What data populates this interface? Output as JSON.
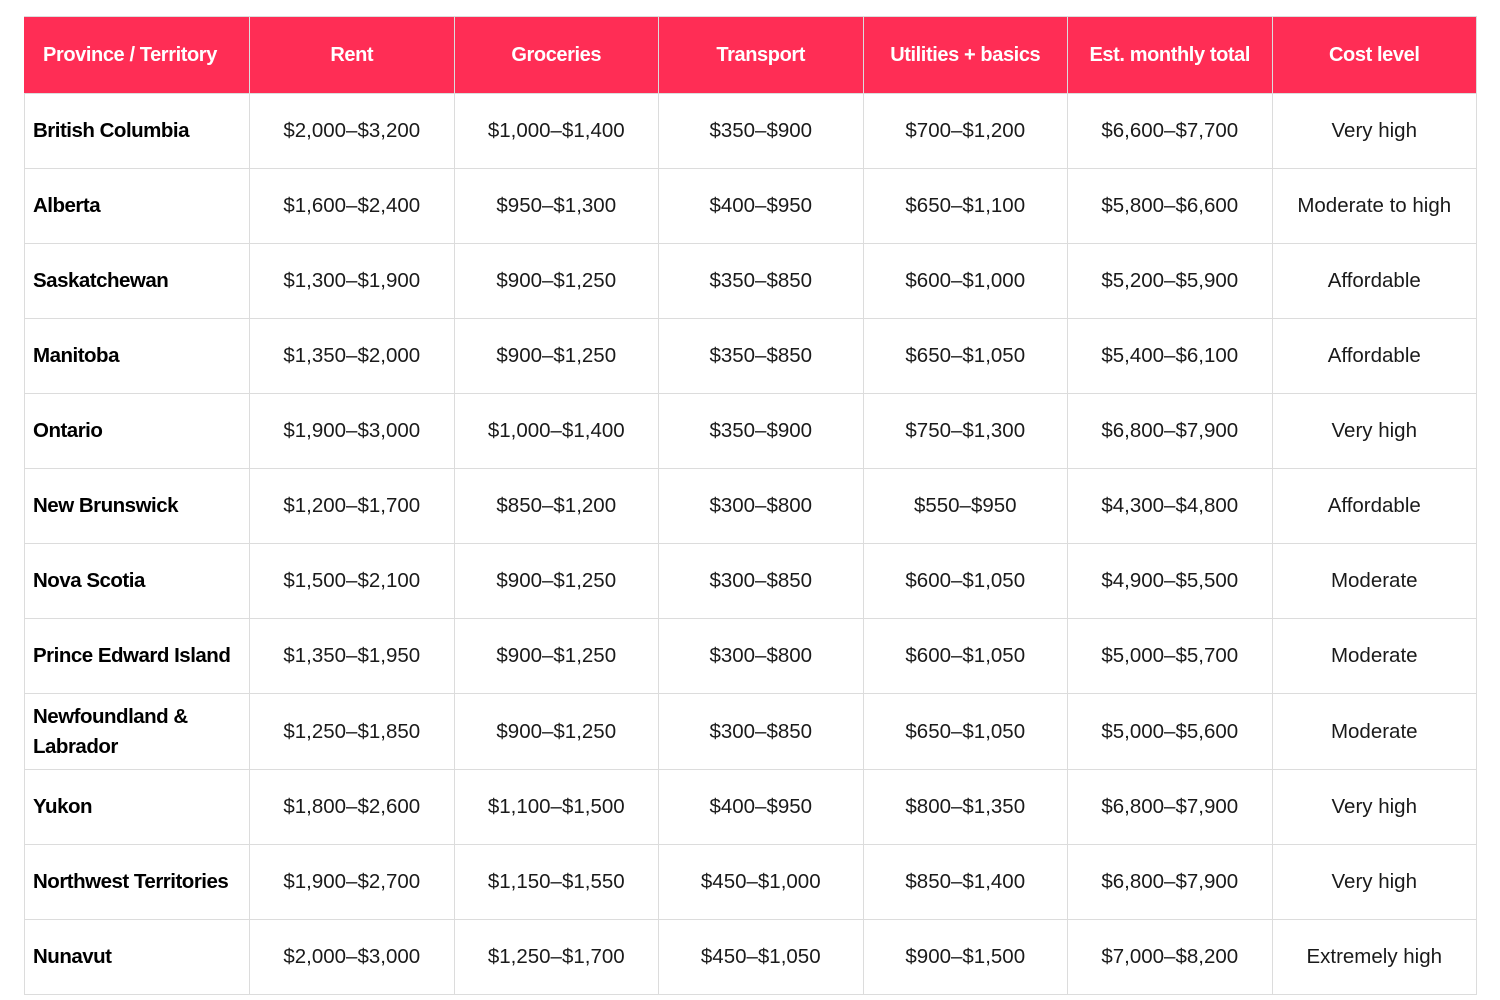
{
  "table": {
    "headers": [
      "Province / Territory",
      "Rent",
      "Groceries",
      "Transport",
      "Utilities + basics",
      "Est. monthly total",
      "Cost level"
    ],
    "rows": [
      [
        "British Columbia",
        "$2,000–$3,200",
        "$1,000–$1,400",
        "$350–$900",
        "$700–$1,200",
        "$6,600–$7,700",
        "Very high"
      ],
      [
        "Alberta",
        "$1,600–$2,400",
        "$950–$1,300",
        "$400–$950",
        "$650–$1,100",
        "$5,800–$6,600",
        "Moderate to high"
      ],
      [
        "Saskatchewan",
        "$1,300–$1,900",
        "$900–$1,250",
        "$350–$850",
        "$600–$1,000",
        "$5,200–$5,900",
        "Affordable"
      ],
      [
        "Manitoba",
        "$1,350–$2,000",
        "$900–$1,250",
        "$350–$850",
        "$650–$1,050",
        "$5,400–$6,100",
        "Affordable"
      ],
      [
        "Ontario",
        "$1,900–$3,000",
        "$1,000–$1,400",
        "$350–$900",
        "$750–$1,300",
        "$6,800–$7,900",
        "Very high"
      ],
      [
        "New Brunswick",
        "$1,200–$1,700",
        "$850–$1,200",
        "$300–$800",
        "$550–$950",
        "$4,300–$4,800",
        "Affordable"
      ],
      [
        "Nova Scotia",
        "$1,500–$2,100",
        "$900–$1,250",
        "$300–$850",
        "$600–$1,050",
        "$4,900–$5,500",
        "Moderate"
      ],
      [
        "Prince Edward Island",
        "$1,350–$1,950",
        "$900–$1,250",
        "$300–$800",
        "$600–$1,050",
        "$5,000–$5,700",
        "Moderate"
      ],
      [
        "Newfoundland & Labrador",
        "$1,250–$1,850",
        "$900–$1,250",
        "$300–$850",
        "$650–$1,050",
        "$5,000–$5,600",
        "Moderate"
      ],
      [
        "Yukon",
        "$1,800–$2,600",
        "$1,100–$1,500",
        "$400–$950",
        "$800–$1,350",
        "$6,800–$7,900",
        "Very high"
      ],
      [
        "Northwest Territories",
        "$1,900–$2,700",
        "$1,150–$1,550",
        "$450–$1,000",
        "$850–$1,400",
        "$6,800–$7,900",
        "Very high"
      ],
      [
        "Nunavut",
        "$2,000–$3,000",
        "$1,250–$1,700",
        "$450–$1,050",
        "$900–$1,500",
        "$7,000–$8,200",
        "Extremely high"
      ]
    ]
  },
  "colors": {
    "header_bg": "#ff2d55",
    "header_text": "#ffffff",
    "grid": "#dcdcdc",
    "body_text": "#1a1a1a"
  }
}
